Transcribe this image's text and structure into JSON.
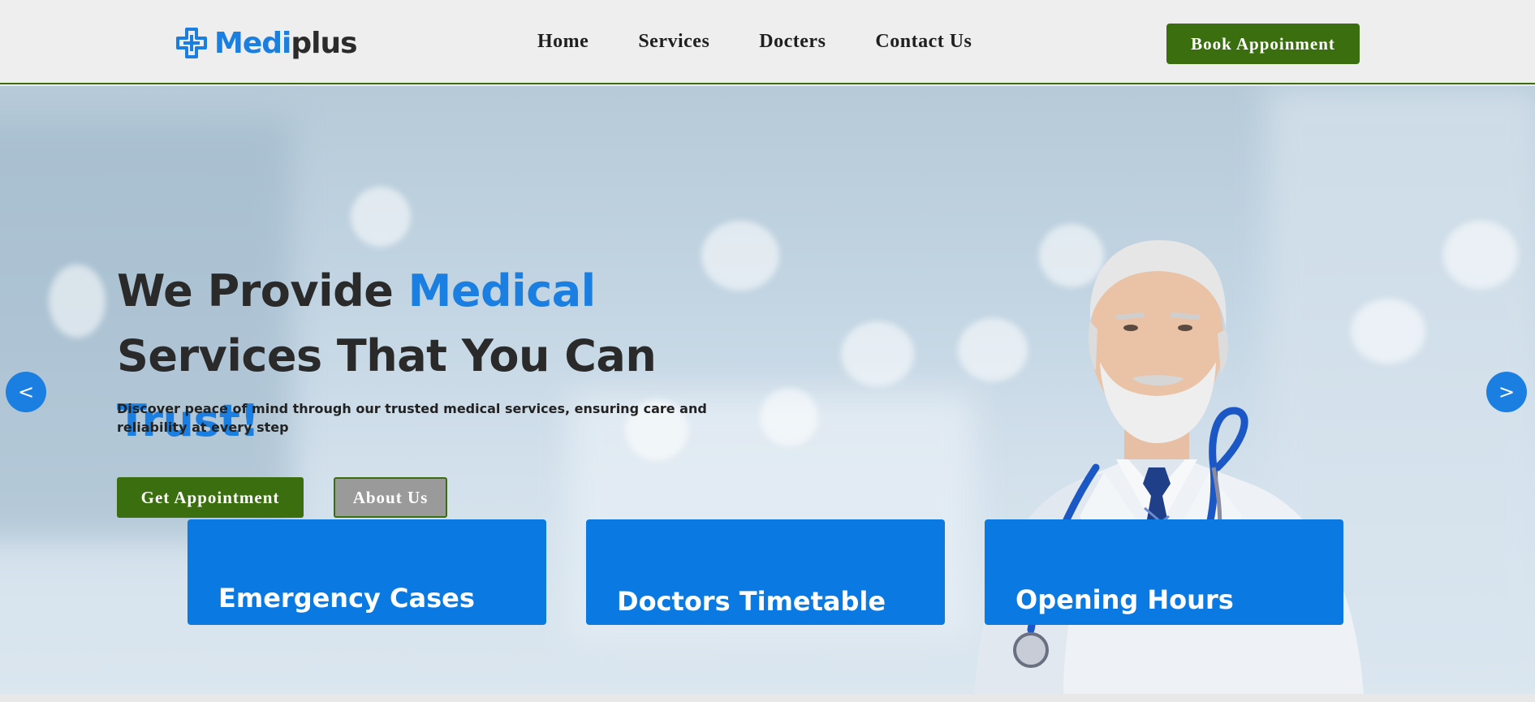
{
  "header": {
    "logo": {
      "medi": "Medi",
      "plus": "plus",
      "icon": "medical-cross-icon"
    },
    "nav": [
      {
        "label": "Home"
      },
      {
        "label": "Services"
      },
      {
        "label": "Docters"
      },
      {
        "label": "Contact Us"
      }
    ],
    "book_button": "Book Appoinment"
  },
  "hero": {
    "title_part1": "We Provide ",
    "title_accent1": "Medical",
    "title_part2": "Services That You Can ",
    "title_accent2": "Trust!",
    "subtitle": "Discover peace of mind through our trusted medical services, ensuring care and reliability at every step",
    "primary_button": "Get Appointment",
    "secondary_button": "About Us",
    "prev_arrow": "<",
    "next_arrow": ">"
  },
  "cards": [
    {
      "title": "Emergency Cases"
    },
    {
      "title": "Doctors Timetable"
    },
    {
      "title": "Opening Hours"
    }
  ],
  "colors": {
    "brand_blue": "#1a7fe0",
    "brand_green": "#3b6e0f",
    "card_blue": "#0a7ae2"
  }
}
